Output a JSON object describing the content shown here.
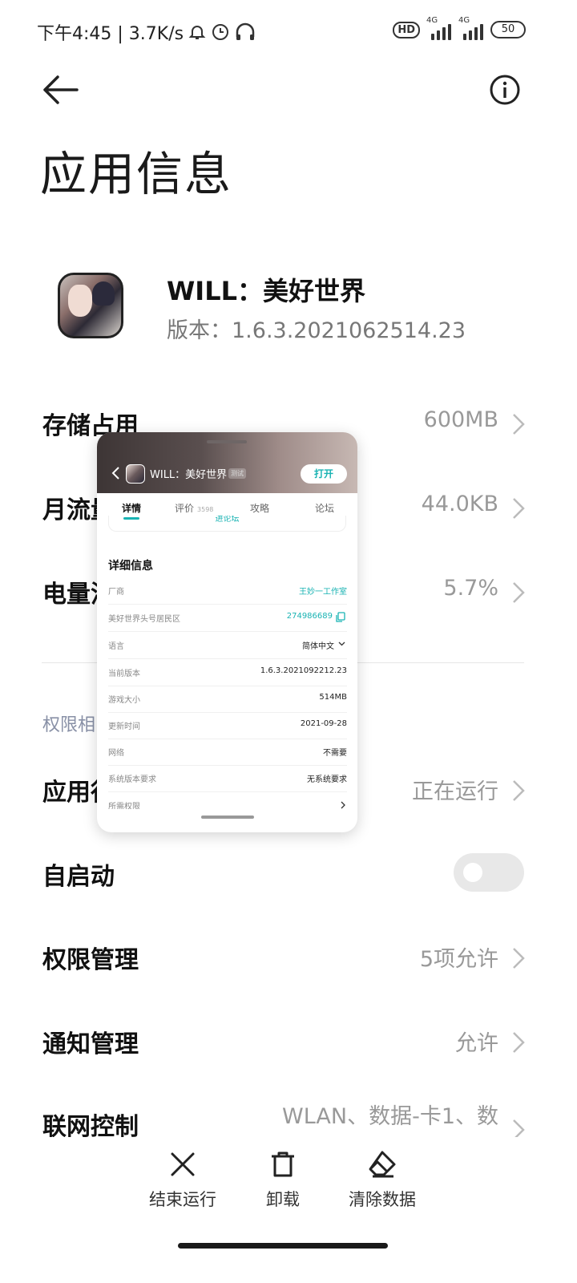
{
  "status_bar": {
    "time_speed": "下午4:45 | 3.7K/s",
    "hd_label": "HD",
    "network_1": "4G",
    "network_2": "4G",
    "battery": "50"
  },
  "header": {
    "title": "应用信息",
    "back_icon": "arrow-left-icon",
    "info_icon": "info-circle-icon"
  },
  "app": {
    "name": "WILL：美好世界",
    "version": "版本：1.6.3.2021062514.23"
  },
  "rows": {
    "storage": {
      "label": "存储占用",
      "value": "600MB"
    },
    "traffic": {
      "label": "月流量",
      "value": "44.0KB"
    },
    "battery": {
      "label": "电量消",
      "value": "5.7%"
    },
    "permissions_section": "权限相",
    "running": {
      "label": "应用行",
      "value": "正在运行"
    },
    "autostart": {
      "label": "自启动",
      "enabled": false
    },
    "permission_mgmt": {
      "label": "权限管理",
      "value": "5项允许"
    },
    "notification_mgmt": {
      "label": "通知管理",
      "value": "允许"
    },
    "network_control": {
      "label": "联网控制",
      "value": "WLAN、数据-卡1、数"
    }
  },
  "bottom_bar": {
    "force_stop": "结束运行",
    "uninstall": "卸载",
    "clear_data": "清除数据"
  },
  "float_window": {
    "title": "WILL：美好世界",
    "tag": "测试",
    "open_button": "打开",
    "tabs": [
      {
        "label": "详情",
        "count": ""
      },
      {
        "label": "评价",
        "count": "3598"
      },
      {
        "label": "攻略",
        "count": ""
      },
      {
        "label": "论坛",
        "count": ""
      }
    ],
    "cut_text": "进论坛",
    "section_title": "详细信息",
    "details": [
      {
        "key": "厂商",
        "value": "王妙一工作室"
      },
      {
        "key": "美好世界头号居民区",
        "value": "274986689"
      },
      {
        "key": "语言",
        "value": "简体中文"
      },
      {
        "key": "当前版本",
        "value": "1.6.3.2021092212.23"
      },
      {
        "key": "游戏大小",
        "value": "514MB"
      },
      {
        "key": "更新时间",
        "value": "2021-09-28"
      },
      {
        "key": "网络",
        "value": "不需要"
      },
      {
        "key": "系统版本要求",
        "value": "无系统要求"
      },
      {
        "key": "所需权限",
        "value": ""
      }
    ]
  },
  "colors": {
    "accent_teal": "#19b3b3",
    "section_title": "#8890a6",
    "value_gray": "#999999"
  }
}
